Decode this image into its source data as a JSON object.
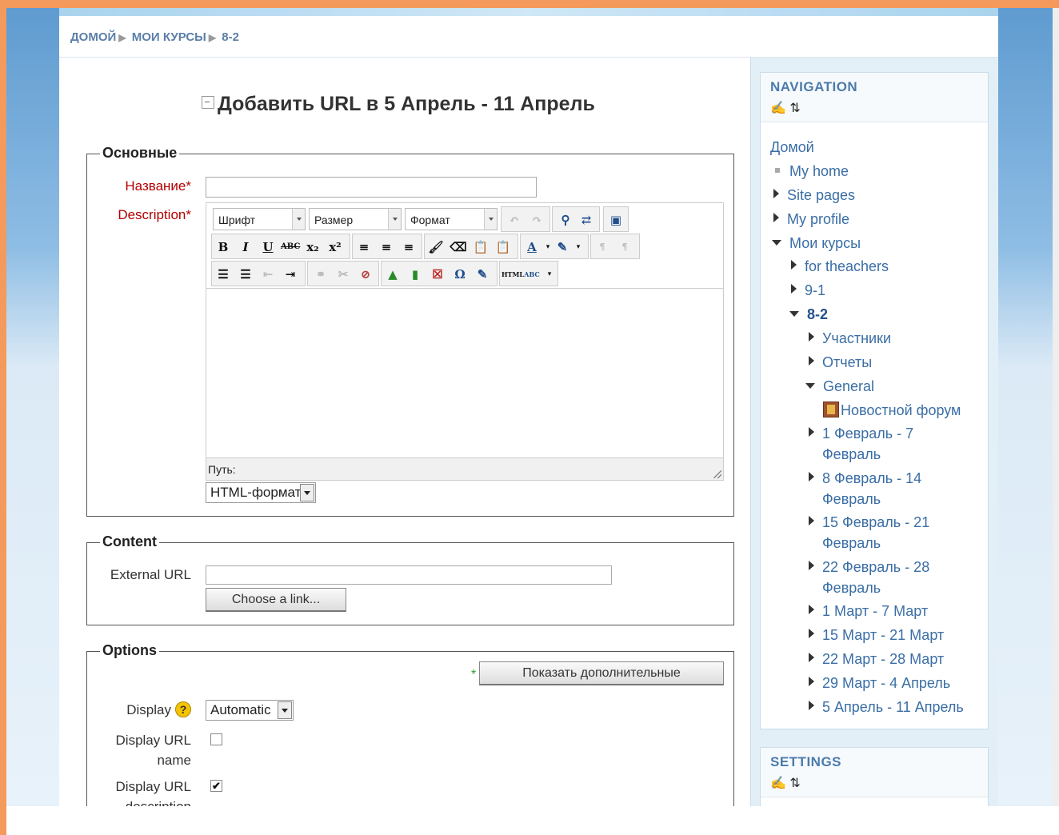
{
  "breadcrumb": {
    "home": "ДОМОЙ",
    "courses": "МОИ КУРСЫ",
    "current": "8-2"
  },
  "page_title": "Добавить URL в 5 Апрель - 11 Апрель",
  "general": {
    "legend": "Основные",
    "name_label": "Название",
    "description_label": "Description",
    "required_mark": "*",
    "toolbar": {
      "font": "Шрифт",
      "size": "Размер",
      "format": "Формат",
      "bold": "B",
      "italic": "I",
      "underline": "U",
      "strike": "ABC",
      "subscript": "x₂",
      "superscript": "x²",
      "html": "HTML",
      "spell": "ABC"
    },
    "path_label": "Путь:",
    "format_select": "HTML-формат"
  },
  "content": {
    "legend": "Content",
    "external_url_label": "External URL",
    "external_url_value": "",
    "choose_link": "Choose a link..."
  },
  "options": {
    "legend": "Options",
    "show_more": "Показать дополнительные",
    "show_more_mark": "*",
    "display_label": "Display",
    "display_value": "Automatic",
    "display_url_name_label": "Display URL name",
    "display_url_name_line1": "Display URL",
    "display_url_name_line2": "name",
    "display_url_name_checked": false,
    "display_url_desc_line1": "Display URL",
    "display_url_desc_line2": "description",
    "display_url_desc_checked": true,
    "check_mark": "✔",
    "help_mark": "?"
  },
  "navigation": {
    "title": "NAVIGATION",
    "items": [
      "Домой",
      "My home",
      "Site pages",
      "My profile",
      "Мои курсы",
      "for theachers",
      "9-1",
      "8-2",
      "Участники",
      "Отчеты",
      "General",
      "Новостной форум",
      "1 Февраль - 7",
      "Февраль",
      "8 Февраль - 14",
      "Февраль",
      "15 Февраль - 21",
      "Февраль",
      "22 Февраль - 28",
      "Февраль",
      "1 Март - 7 Март",
      "15 Март - 21 Март",
      "22 Март - 28 Март",
      "29 Март - 4 Апрель",
      "5 Апрель - 11 Апрель"
    ]
  },
  "settings": {
    "title": "SETTINGS"
  },
  "block_icons": "✍ ⇅"
}
